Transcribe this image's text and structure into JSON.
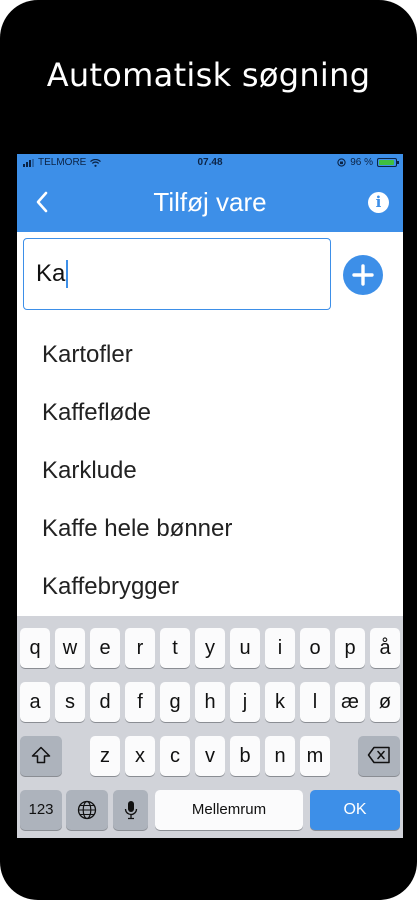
{
  "promo": {
    "caption": "Automatisk søgning"
  },
  "status_bar": {
    "carrier": "TELMORE",
    "time": "07.48",
    "battery_text": "96 %"
  },
  "nav": {
    "title": "Tilføj vare",
    "back_icon": "chevron-left-icon",
    "info_icon": "info-icon"
  },
  "search": {
    "value": "Ka",
    "add_icon": "plus-icon"
  },
  "suggestions": [
    "Kartofler",
    "Kaffefløde",
    "Karklude",
    "Kaffe hele bønner",
    "Kaffebrygger"
  ],
  "keyboard": {
    "row1": [
      "q",
      "w",
      "e",
      "r",
      "t",
      "y",
      "u",
      "i",
      "o",
      "p",
      "å"
    ],
    "row2": [
      "a",
      "s",
      "d",
      "f",
      "g",
      "h",
      "j",
      "k",
      "l",
      "æ",
      "ø"
    ],
    "row3": [
      "z",
      "x",
      "c",
      "v",
      "b",
      "n",
      "m"
    ],
    "numbers_label": "123",
    "space_label": "Mellemrum",
    "ok_label": "OK"
  },
  "colors": {
    "accent": "#3d8fe8",
    "keyboard_bg": "#d1d3d9",
    "frame": "#000000"
  }
}
